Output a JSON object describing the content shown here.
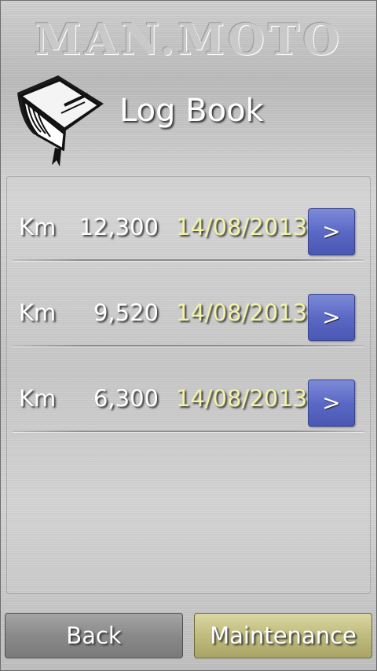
{
  "header": {
    "brand": "MAN.MOTO",
    "title": "Log Book",
    "icon": "logbook-icon"
  },
  "entries": [
    {
      "unit": "Km",
      "odometer": "12,300",
      "date": "14/08/2013",
      "action_label": ">"
    },
    {
      "unit": "Km",
      "odometer": "9,520",
      "date": "14/08/2013",
      "action_label": ">"
    },
    {
      "unit": "Km",
      "odometer": "6,300",
      "date": "14/08/2013",
      "action_label": ">"
    }
  ],
  "footer": {
    "back_label": "Back",
    "maintenance_label": "Maintenance"
  },
  "colors": {
    "date_text": "#f1f3a8",
    "open_button": "#5b69c6",
    "maintenance_button": "#c0bc7e",
    "back_button": "#8a8a8a"
  }
}
